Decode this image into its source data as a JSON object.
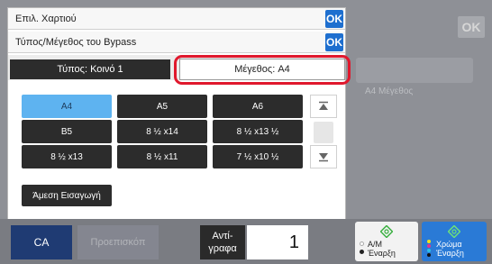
{
  "background": {
    "ok_label": "OK",
    "ghost_size_label": "Α4 Μέγεθος"
  },
  "dialog": {
    "paper_select_label": "Επιλ. Χαρτιού",
    "ok_label": "OK",
    "bypass_title": "Τύπος/Μέγεθος του Bypass",
    "bypass_ok_label": "OK",
    "tabs": {
      "type_label": "Τύπος: Κοινό 1",
      "size_label": "Μέγεθος: A4"
    },
    "sizes": [
      {
        "label": "A4",
        "selected": true
      },
      {
        "label": "A5",
        "selected": false
      },
      {
        "label": "A6",
        "selected": false
      },
      {
        "label": "B5",
        "selected": false
      },
      {
        "label": "8 ½ x14",
        "selected": false
      },
      {
        "label": "8 ½ x13 ½",
        "selected": false
      },
      {
        "label": "8 ½ x13",
        "selected": false
      },
      {
        "label": "8 ½ x11",
        "selected": false
      },
      {
        "label": "7 ½ x10 ½",
        "selected": false
      }
    ],
    "scroll_up_icon": "scroll-up-icon",
    "scroll_down_icon": "scroll-down-icon",
    "direct_entry_label": "Άμεση Εισαγωγή"
  },
  "bottom": {
    "ca_label": "CA",
    "preview_label": "Προεπισκόπ",
    "copies_label": "Αντί-γραφα",
    "copies_value": "1",
    "start_bw_label_1": "Α/Μ",
    "start_bw_label_2": "Έναρξη",
    "start_color_label_1": "Χρώμα",
    "start_color_label_2": "Έναρξη"
  },
  "colors": {
    "ok_blue": "#1e6fcf",
    "selected_size": "#5eb3f0",
    "highlight_red": "#e0182d",
    "color_start_blue": "#2a7ad6",
    "ca_blue": "#1f3b73"
  }
}
